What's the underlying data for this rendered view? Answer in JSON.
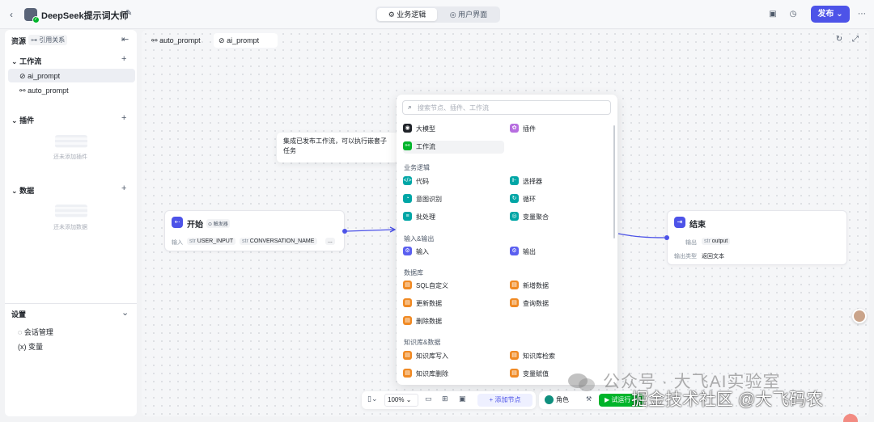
{
  "header": {
    "back_icon": "chevron-left-icon",
    "app_title": "DeepSeek提示词大师",
    "tabs": [
      {
        "label": "业务逻辑",
        "icon": "logic-icon",
        "active": true
      },
      {
        "label": "用户界面",
        "icon": "ui-icon",
        "active": false
      }
    ],
    "publish_label": "发布",
    "accent_color": "#4d53e8"
  },
  "sidebar": {
    "title": "资源",
    "ref_chip": "引用关系",
    "workflow_section": "工作流",
    "workflows": [
      {
        "label": "ai_prompt",
        "icon": "workflow-check-icon",
        "active": true
      },
      {
        "label": "auto_prompt",
        "icon": "workflow-icon",
        "active": false
      }
    ],
    "plugin_section": "插件",
    "plugin_empty": "还未添加插件",
    "data_section": "数据",
    "data_empty": "还未添加数据",
    "settings_section": "设置",
    "settings_items": [
      {
        "label": "会话管理",
        "icon": "chat-icon"
      },
      {
        "label": "变量",
        "icon": "variable-icon"
      }
    ]
  },
  "canvas": {
    "tabs": [
      {
        "label": "auto_prompt",
        "icon": "workflow-icon",
        "active": false
      },
      {
        "label": "ai_prompt",
        "icon": "workflow-check-icon",
        "active": true
      }
    ],
    "tooltip": "集成已发布工作流，可以执行嵌套子任务",
    "start_node": {
      "title": "开始",
      "badge": "触发器",
      "input_label": "输入",
      "inputs": [
        {
          "type": "str",
          "name": "USER_INPUT"
        },
        {
          "type": "str",
          "name": "CONVERSATION_NAME"
        }
      ],
      "more": "..."
    },
    "end_node": {
      "title": "结束",
      "output_label": "输出",
      "output_type": "str",
      "output_name": "output",
      "output_type_label": "输出类型",
      "output_type_value": "返回文本"
    }
  },
  "picker": {
    "search_placeholder": "搜索节点、插件、工作流",
    "top_items": [
      {
        "label": "大模型",
        "icon": "llm-icon",
        "color": "#1f2329"
      },
      {
        "label": "插件",
        "icon": "plugin-icon",
        "color": "#b76ee0"
      },
      {
        "label": "工作流",
        "icon": "workflow-icon",
        "color": "#00b42a",
        "highlighted": true
      }
    ],
    "sections": [
      {
        "title": "业务逻辑",
        "items": [
          {
            "label": "代码",
            "icon": "code-icon",
            "color": "#00a6a6"
          },
          {
            "label": "选择器",
            "icon": "selector-icon",
            "color": "#00a6a6"
          },
          {
            "label": "意图识别",
            "icon": "intent-icon",
            "color": "#00a6a6"
          },
          {
            "label": "循环",
            "icon": "loop-icon",
            "color": "#00a6a6"
          },
          {
            "label": "批处理",
            "icon": "batch-icon",
            "color": "#00a6a6"
          },
          {
            "label": "变量聚合",
            "icon": "aggregate-icon",
            "color": "#00a6a6"
          }
        ]
      },
      {
        "title": "输入&输出",
        "items": [
          {
            "label": "输入",
            "icon": "input-icon",
            "color": "#5a5ff0"
          },
          {
            "label": "输出",
            "icon": "output-icon",
            "color": "#5a5ff0"
          }
        ]
      },
      {
        "title": "数据库",
        "items": [
          {
            "label": "SQL自定义",
            "icon": "sql-icon",
            "color": "#f08a24"
          },
          {
            "label": "新增数据",
            "icon": "add-data-icon",
            "color": "#f08a24"
          },
          {
            "label": "更新数据",
            "icon": "update-data-icon",
            "color": "#f08a24"
          },
          {
            "label": "查询数据",
            "icon": "query-data-icon",
            "color": "#f08a24"
          },
          {
            "label": "删除数据",
            "icon": "delete-data-icon",
            "color": "#f08a24"
          }
        ]
      },
      {
        "title": "知识库&数据",
        "items": [
          {
            "label": "知识库写入",
            "icon": "kb-write-icon",
            "color": "#f08a24"
          },
          {
            "label": "知识库检索",
            "icon": "kb-search-icon",
            "color": "#f08a24"
          },
          {
            "label": "知识库删除",
            "icon": "kb-delete-icon",
            "color": "#f08a24"
          },
          {
            "label": "变量赋值",
            "icon": "assign-icon",
            "color": "#f08a24"
          }
        ]
      }
    ]
  },
  "toolbar": {
    "zoom": "100%",
    "add_node_label": "添加节点",
    "role_label": "角色",
    "run_label": "试运行"
  },
  "watermark": {
    "line1": "公众号 · 大飞AI实验室",
    "line2": "掘金技术社区 @大飞码农"
  }
}
